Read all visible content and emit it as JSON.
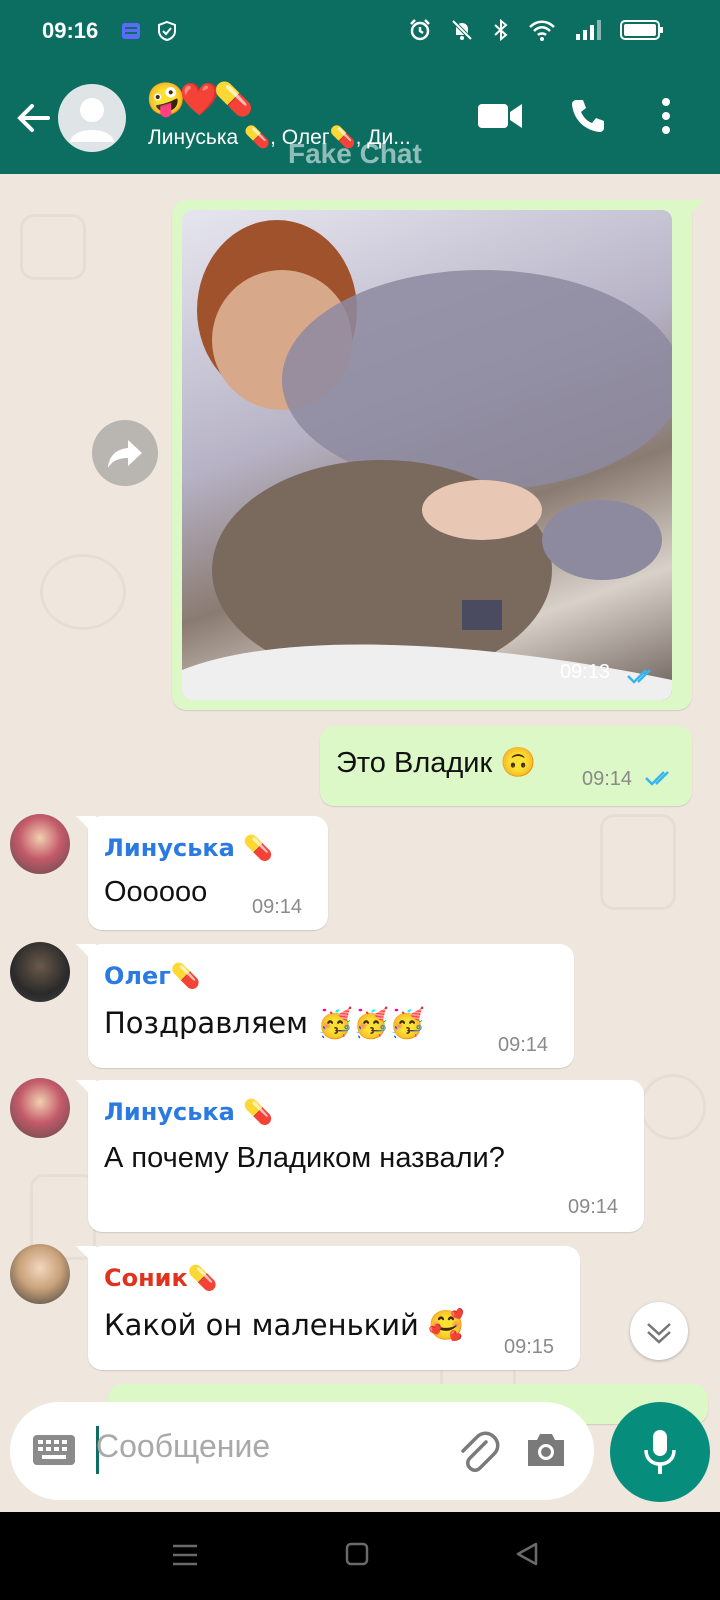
{
  "status_bar": {
    "time": "09:16"
  },
  "header": {
    "title_emoji": "🤪❤️💊",
    "participants": "Линуська 💊, Олег💊, Ди...",
    "watermark": "Fake Chat"
  },
  "messages": [
    {
      "type": "image",
      "direction": "out",
      "time": "09:13",
      "ticks": "read"
    },
    {
      "type": "text",
      "direction": "out",
      "text": "Это Владик 🙃",
      "time": "09:14",
      "ticks": "read"
    },
    {
      "type": "text",
      "direction": "in",
      "sender": "Линуська 💊",
      "sender_color": "#2a7ae2",
      "text": "Оооооо",
      "time": "09:14"
    },
    {
      "type": "text",
      "direction": "in",
      "sender": "Олег💊",
      "sender_color": "#2a7ae2",
      "text": "Поздравляем 🥳🥳🥳",
      "time": "09:14"
    },
    {
      "type": "text",
      "direction": "in",
      "sender": "Линуська 💊",
      "sender_color": "#2a7ae2",
      "text": "А почему Владиком назвали?",
      "time": "09:14"
    },
    {
      "type": "text",
      "direction": "in",
      "sender": "Соник💊",
      "sender_color": "#e0331e",
      "text": "Какой он маленький 🥰",
      "time": "09:15"
    }
  ],
  "input": {
    "placeholder": "Сообщение"
  },
  "colors": {
    "header": "#0b6e61",
    "outgoing_bubble": "#dcf8c6",
    "incoming_bubble": "#ffffff",
    "accent": "#078d7b",
    "ticks": "#34b7f1"
  },
  "icons": [
    "back-arrow-icon",
    "video-call-icon",
    "phone-icon",
    "more-options-icon",
    "forward-icon",
    "chevron-down-icon",
    "keyboard-icon",
    "attach-icon",
    "camera-icon",
    "mic-icon"
  ]
}
